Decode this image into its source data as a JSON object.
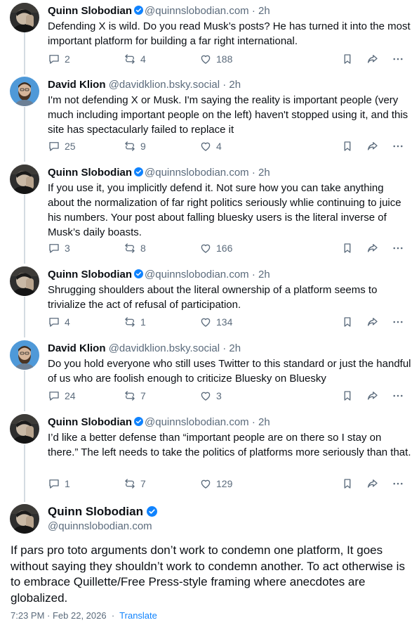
{
  "colors": {
    "text": "#0b0f14",
    "muted": "#5b6b7c",
    "accent": "#1083fe",
    "thread_line": "#d4dbe2"
  },
  "posts": [
    {
      "name": "Quinn Slobodian",
      "verified": true,
      "handle": "@quinnslobodian.com",
      "separator": "·",
      "time": "2h",
      "text": "Defending X is wild. Do you read Musk’s posts? He has turned it into the most important platform for building a far right international.",
      "replies": "2",
      "reposts": "4",
      "likes": "188"
    },
    {
      "name": "David Klion",
      "verified": false,
      "handle": "@davidklion.bsky.social",
      "separator": "·",
      "time": "2h",
      "text": "I'm not defending X or Musk. I'm saying the reality is important people (very much including important people on the left) haven't stopped using it, and this site has spectacularly failed to replace it",
      "replies": "25",
      "reposts": "9",
      "likes": "4"
    },
    {
      "name": "Quinn Slobodian",
      "verified": true,
      "handle": "@quinnslobodian.com",
      "separator": "·",
      "time": "2h",
      "text": "If you use it, you implicitly defend it. Not sure how you can take anything about the normalization of far right politics seriously whlie continuing to juice his numbers. Your post about falling bluesky users is the literal inverse of Musk’s daily boasts.",
      "replies": "3",
      "reposts": "8",
      "likes": "166"
    },
    {
      "name": "Quinn Slobodian",
      "verified": true,
      "handle": "@quinnslobodian.com",
      "separator": "·",
      "time": "2h",
      "text": "Shrugging shoulders about the literal ownership of a platform seems to trivialize the act of refusal of participation.",
      "replies": "4",
      "reposts": "1",
      "likes": "134"
    },
    {
      "name": "David Klion",
      "verified": false,
      "handle": "@davidklion.bsky.social",
      "separator": "·",
      "time": "2h",
      "text": "Do you hold everyone who still uses Twitter to this standard or just the handful of us who are foolish enough to criticize Bluesky on Bluesky",
      "replies": "24",
      "reposts": "7",
      "likes": "3"
    },
    {
      "name": "Quinn Slobodian",
      "verified": true,
      "handle": "@quinnslobodian.com",
      "separator": "·",
      "time": "2h",
      "text": "I’d like a better defense than “important people are on there so I stay on there.” The left needs to take the politics of platforms more seriously than that.",
      "replies": "1",
      "reposts": "7",
      "likes": "129"
    }
  ],
  "focused_post": {
    "name": "Quinn Slobodian",
    "verified": true,
    "handle": "@quinnslobodian.com",
    "text": "If pars pro toto arguments don’t work to condemn one platform, It goes without saying they shouldn’t work to condemn another. To act otherwise is to embrace Quillette/Free Press-style framing where anecdotes are globalized.",
    "timestamp": "7:23 PM · Feb 22, 2026",
    "separator": "·",
    "translate_label": "Translate"
  }
}
